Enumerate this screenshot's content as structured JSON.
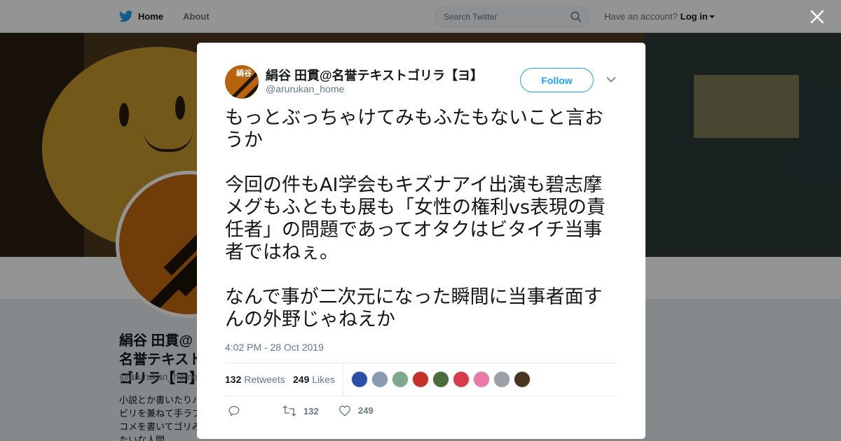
{
  "nav": {
    "home_label": "Home",
    "about_label": "About",
    "search_placeholder": "Search Twitter",
    "account_prompt": "Have an account?",
    "login_label": "Log in"
  },
  "background_profile": {
    "name": "絹谷 田貫@名誉テキストゴリラ【ヨ】",
    "handle": "@arurukan_home",
    "bio": "小説とか書いたりハビリを兼ねて手ラブコメを書いてゴリみたいな人間"
  },
  "tweet": {
    "author_name": "絹谷 田貫@名誉テキストゴリラ【ヨ】",
    "author_handle": "@arurukan_home",
    "avatar_text": "絹谷",
    "follow_label": "Follow",
    "paragraphs": [
      "もっとぶっちゃけてみもふたもないこと言おうか",
      "今回の件もAI学会もキズナアイ出演も碧志摩メグもふともも展も「女性の権利vs表現の責任者」の問題であってオタクはビタイチ当事者ではねぇ。",
      "なんで事が二次元になった瞬間に当事者面すんの外野じゃねえか"
    ],
    "timestamp": "4:02 PM - 28 Oct 2019",
    "retweets_count": "132",
    "retweets_label": "Retweets",
    "likes_count": "249",
    "likes_label": "Likes",
    "liker_colors": [
      "#2a4fa8",
      "#8a9ab0",
      "#7fa88f",
      "#c8302a",
      "#4a6b3a",
      "#d93b4a",
      "#e87aa8",
      "#9aa0a6",
      "#4a3420"
    ],
    "action_retweet_count": "132",
    "action_like_count": "249"
  },
  "icons": [
    "twitter-bird-icon",
    "search-icon",
    "close-icon",
    "chevron-down-icon",
    "reply-icon",
    "retweet-icon",
    "heart-icon"
  ]
}
